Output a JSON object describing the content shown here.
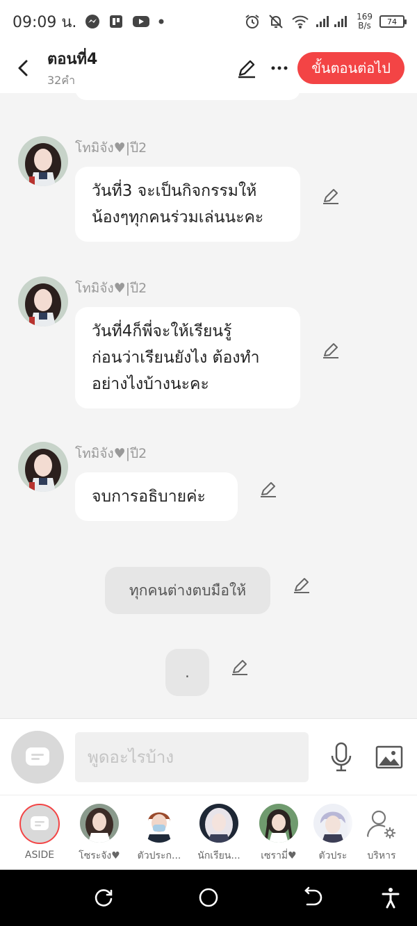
{
  "status_bar": {
    "time": "09:09 น.",
    "net_speed_value": "169",
    "net_speed_unit": "B/s",
    "battery": "74"
  },
  "header": {
    "title": "ตอนที่4",
    "word_count": "32คำ",
    "next_step_label": "ขั้นตอนต่อไป"
  },
  "messages": [
    {
      "sender": "โทมิจัง♥|ปี2",
      "text": "วันที่3 จะเป็นกิจกรรมให้\nน้องๆทุกคนร่วมเล่นนะคะ"
    },
    {
      "sender": "โทมิจัง♥|ปี2",
      "text": "วันที่4ก็พี่จะให้เรียนรู้\nก่อนว่าเรียนยังไง ต้องทำ\nอย่างไงบ้างนะคะ"
    },
    {
      "sender": "โทมิจัง♥|ปี2",
      "text": "จบการอธิบายค่ะ"
    }
  ],
  "narrations": [
    {
      "text": "ทุกคนต่างตบมือให้"
    },
    {
      "text": "."
    }
  ],
  "composer": {
    "placeholder": "พูดอะไรบ้าง"
  },
  "characters": [
    {
      "label": "ASIDE"
    },
    {
      "label": "โซระจัง♥"
    },
    {
      "label": "ตัวประก..."
    },
    {
      "label": "นักเรียน..."
    },
    {
      "label": "เซรามี่♥"
    },
    {
      "label": "ตัวประ"
    },
    {
      "label": "บริหาร"
    }
  ],
  "colors": {
    "accent": "#f34445",
    "background": "#f4f4f4",
    "bubble": "#ffffff",
    "narration": "#e6e6e6"
  }
}
